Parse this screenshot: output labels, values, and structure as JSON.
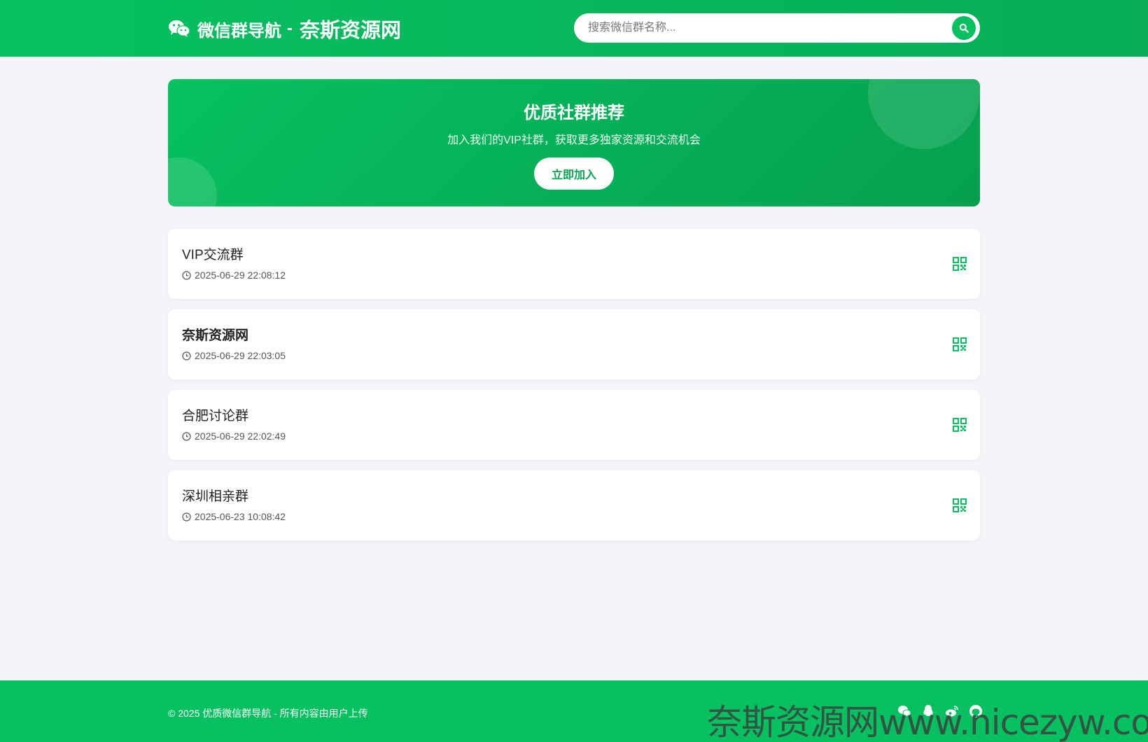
{
  "header": {
    "title": "微信群导航",
    "separator": "-",
    "site_name": "奈斯资源网",
    "search_placeholder": "搜索微信群名称..."
  },
  "banner": {
    "title": "优质社群推荐",
    "subtitle": "加入我们的VIP社群，获取更多独家资源和交流机会",
    "join_label": "立即加入"
  },
  "groups": [
    {
      "name": "VIP交流群",
      "time": "2025-06-29 22:08:12"
    },
    {
      "name": "奈斯资源网",
      "time": "2025-06-29 22:03:05"
    },
    {
      "name": "合肥讨论群",
      "time": "2025-06-29 22:02:49"
    },
    {
      "name": "深圳相亲群",
      "time": "2025-06-23 10:08:42"
    }
  ],
  "footer": {
    "copyright": "© 2025 优质微信群导航 - 所有内容由用户上传",
    "social_icons": [
      "wechat-icon",
      "qq-icon",
      "weibo-icon",
      "github-icon"
    ]
  },
  "watermark": "奈斯资源网www.nicezyw.com",
  "colors": {
    "primary": "#07c160",
    "background": "#f4f5f9"
  }
}
